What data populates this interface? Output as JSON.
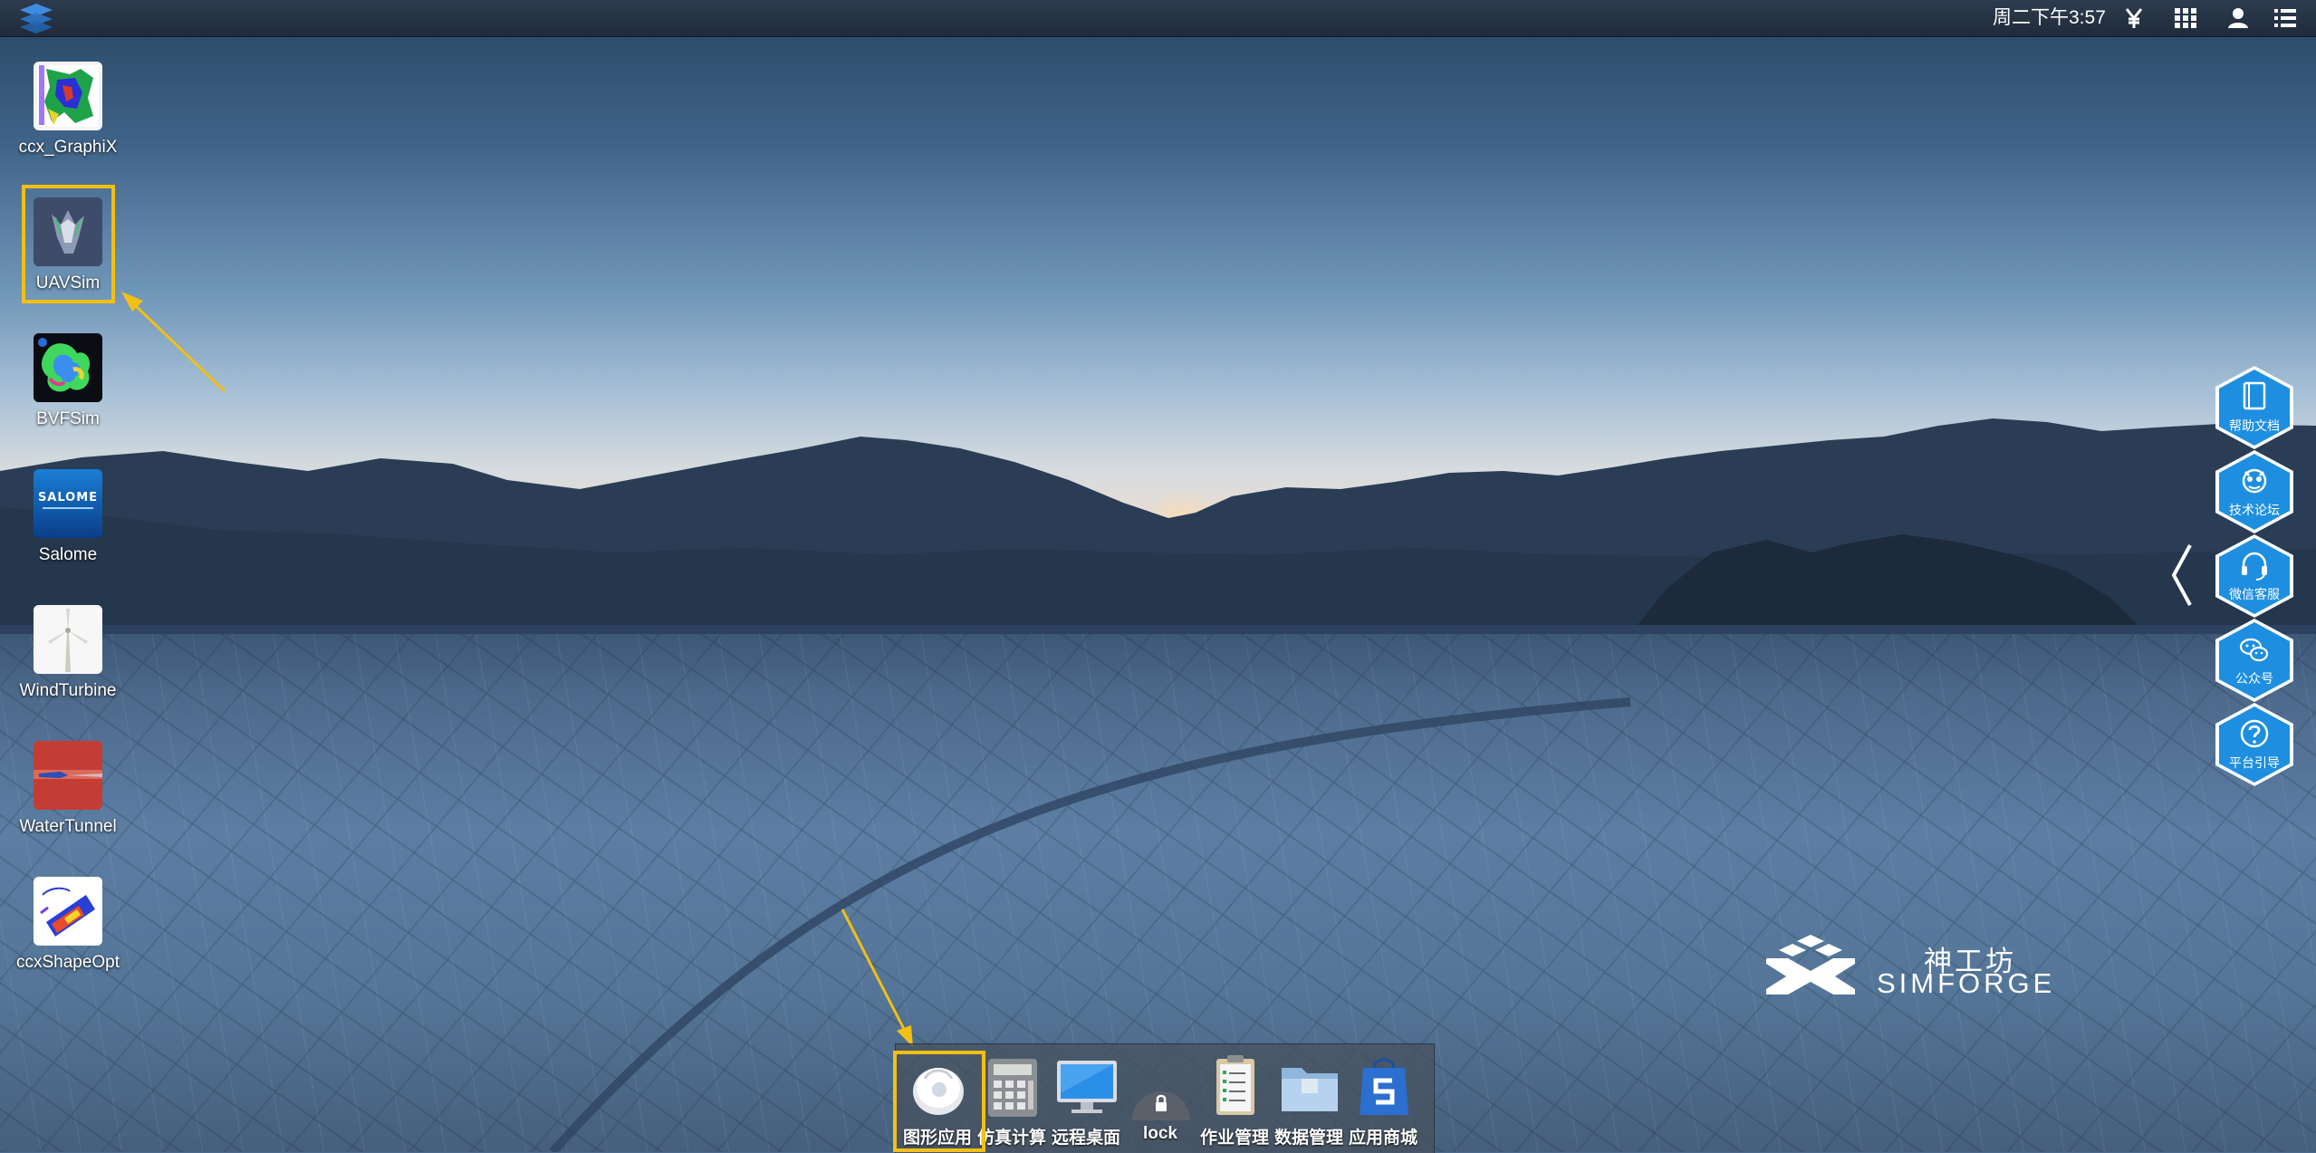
{
  "topbar": {
    "clock": "周二下午3:57",
    "icons": [
      "yen-icon",
      "apps-grid-icon",
      "user-icon",
      "menu-list-icon"
    ]
  },
  "desktop": {
    "icons": [
      {
        "label": "ccx_GraphiX",
        "icon": "ccx-graphix-icon"
      },
      {
        "label": "UAVSim",
        "icon": "uavsim-icon"
      },
      {
        "label": "BVFSim",
        "icon": "bvfsim-icon"
      },
      {
        "label": "Salome",
        "icon": "salome-icon",
        "tile_text": "SALOME"
      },
      {
        "label": "WindTurbine",
        "icon": "wind-turbine-icon"
      },
      {
        "label": "WaterTunnel",
        "icon": "water-tunnel-icon"
      },
      {
        "label": "ccxShapeOpt",
        "icon": "ccx-shapeopt-icon"
      }
    ]
  },
  "sidebar": {
    "items": [
      {
        "label": "帮助文档",
        "icon": "book-icon"
      },
      {
        "label": "技术论坛",
        "icon": "forum-icon"
      },
      {
        "label": "微信客服",
        "icon": "headset-icon"
      },
      {
        "label": "公众号",
        "icon": "wechat-icon"
      },
      {
        "label": "平台引导",
        "icon": "question-icon"
      }
    ]
  },
  "brand": {
    "cn": "神工坊",
    "en": "SIMFORGE"
  },
  "dock": {
    "items": [
      {
        "label": "图形应用",
        "icon": "graphics-app-icon"
      },
      {
        "label": "仿真计算",
        "icon": "calculator-icon"
      },
      {
        "label": "远程桌面",
        "icon": "monitor-icon"
      },
      {
        "label": "lock",
        "icon": "lock-icon"
      },
      {
        "label": "作业管理",
        "icon": "clipboard-icon"
      },
      {
        "label": "数据管理",
        "icon": "folder-icon"
      },
      {
        "label": "应用商城",
        "icon": "store-icon"
      }
    ]
  },
  "colors": {
    "highlight": "#f2bf14",
    "sidebar_blue": "#1e8fe0",
    "topbar": "#253244"
  }
}
